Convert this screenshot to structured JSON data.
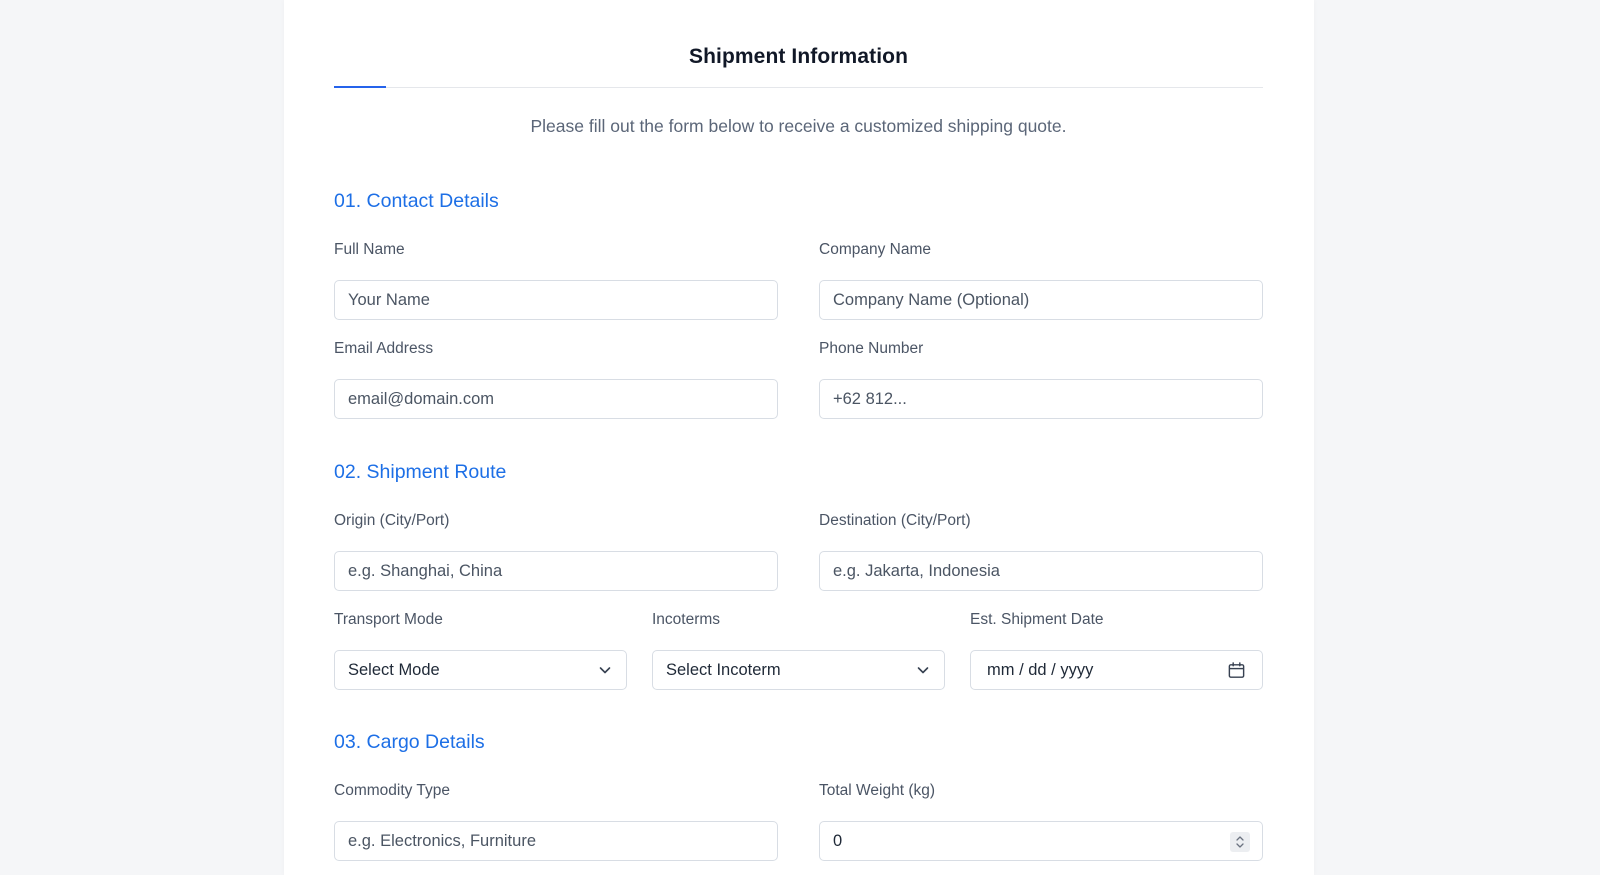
{
  "header": {
    "title": "Shipment Information",
    "subtitle": "Please fill out the form below to receive a customized shipping quote."
  },
  "sections": {
    "contact": {
      "title": "01. Contact Details",
      "full_name": {
        "label": "Full Name",
        "placeholder": "Your Name"
      },
      "company_name": {
        "label": "Company Name",
        "placeholder": "Company Name (Optional)"
      },
      "email": {
        "label": "Email Address",
        "placeholder": "email@domain.com"
      },
      "phone": {
        "label": "Phone Number",
        "placeholder": "+62 812..."
      }
    },
    "route": {
      "title": "02. Shipment Route",
      "origin": {
        "label": "Origin (City/Port)",
        "placeholder": "e.g. Shanghai, China"
      },
      "destination": {
        "label": "Destination (City/Port)",
        "placeholder": "e.g. Jakarta, Indonesia"
      },
      "transport_mode": {
        "label": "Transport Mode",
        "value": "Select Mode"
      },
      "incoterms": {
        "label": "Incoterms",
        "value": "Select Incoterm"
      },
      "shipment_date": {
        "label": "Est. Shipment Date",
        "value": "mm / dd / yyyy"
      }
    },
    "cargo": {
      "title": "03. Cargo Details",
      "commodity": {
        "label": "Commodity Type",
        "placeholder": "e.g. Electronics, Furniture"
      },
      "weight": {
        "label": "Total Weight (kg)",
        "value": "0"
      }
    }
  },
  "icons": {
    "select_chevron": "chevron-down-icon",
    "date": "calendar-icon",
    "number": "spinner-icon"
  },
  "colors": {
    "accent": "#2563eb",
    "section_title": "#1d6fe6",
    "background": "#f5f6f8"
  }
}
